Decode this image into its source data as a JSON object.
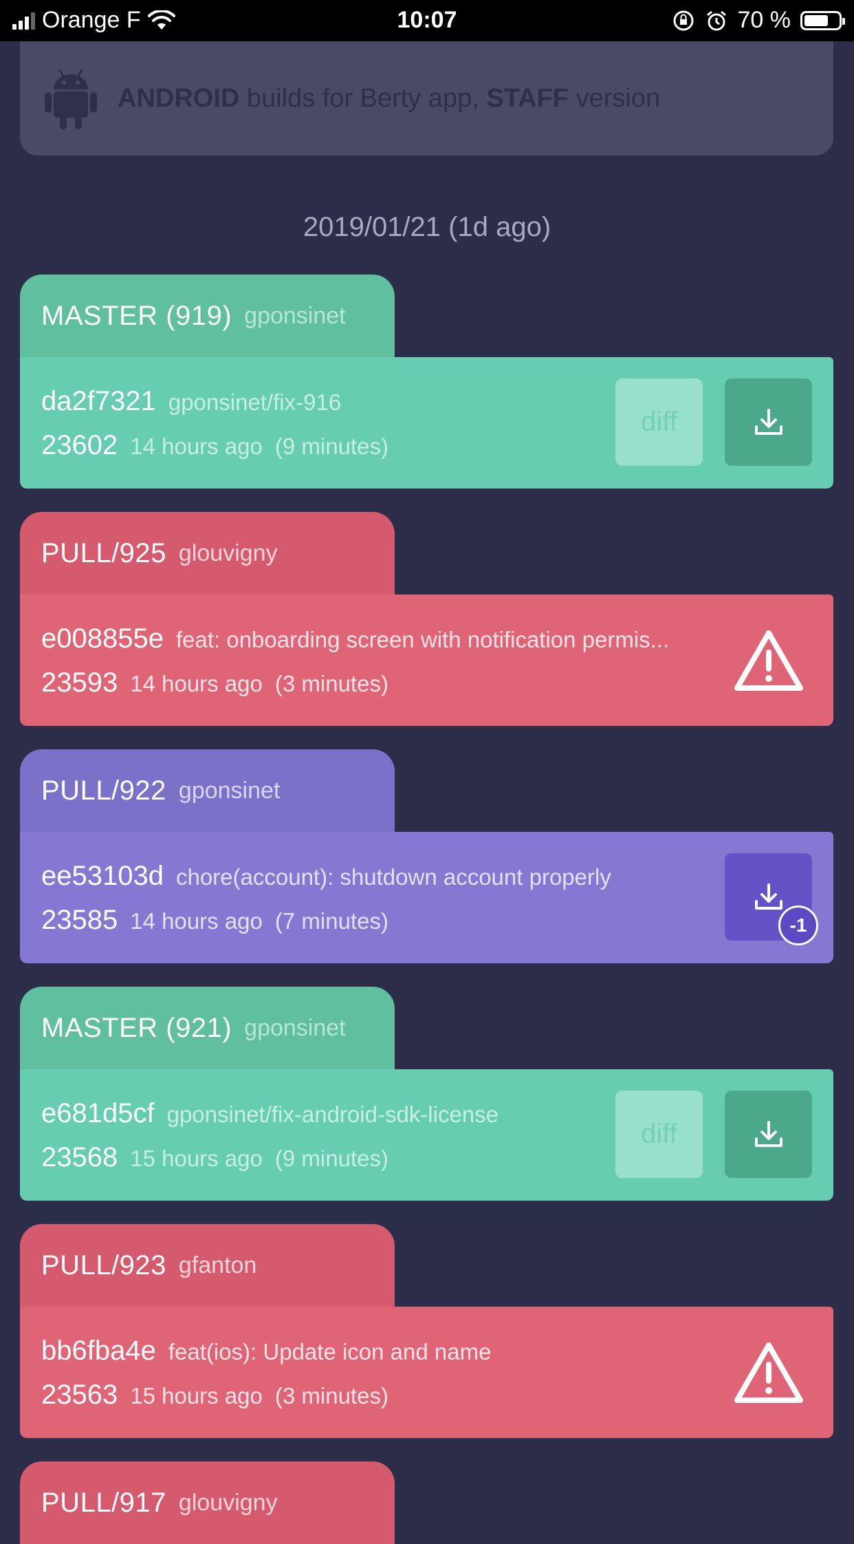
{
  "status_bar": {
    "carrier": "Orange F",
    "time": "10:07",
    "battery": "70 %",
    "battery_level": 0.7
  },
  "banner": {
    "platform": "ANDROID",
    "text_mid": " builds for Berty app, ",
    "variant": "STAFF",
    "text_end": " version"
  },
  "date_header": "2019/01/21 (1d ago)",
  "builds": [
    {
      "kind": "green",
      "branch": "MASTER (919)",
      "author": "gponsinet",
      "hash": "da2f7321",
      "message": "gponsinet/fix-916",
      "number": "23602",
      "ago": "14 hours ago",
      "duration": "(9 minutes)",
      "diff_label": "diff",
      "action": "download"
    },
    {
      "kind": "red",
      "branch": "PULL/925",
      "author": "glouvigny",
      "hash": "e008855e",
      "message": "feat: onboarding screen with notification permis...",
      "number": "23593",
      "ago": "14 hours ago",
      "duration": "(3 minutes)",
      "action": "warning"
    },
    {
      "kind": "purple",
      "branch": "PULL/922",
      "author": "gponsinet",
      "hash": "ee53103d",
      "message": "chore(account): shutdown account properly",
      "number": "23585",
      "ago": "14 hours ago",
      "duration": "(7 minutes)",
      "action": "download",
      "badge": "-1"
    },
    {
      "kind": "green",
      "branch": "MASTER (921)",
      "author": "gponsinet",
      "hash": "e681d5cf",
      "message": "gponsinet/fix-android-sdk-license",
      "number": "23568",
      "ago": "15 hours ago",
      "duration": "(9 minutes)",
      "diff_label": "diff",
      "action": "download"
    },
    {
      "kind": "red",
      "branch": "PULL/923",
      "author": "gfanton",
      "hash": "bb6fba4e",
      "message": "feat(ios): Update icon and name",
      "number": "23563",
      "ago": "15 hours ago",
      "duration": "(3 minutes)",
      "action": "warning"
    },
    {
      "kind": "red",
      "branch": "PULL/917",
      "author": "glouvigny"
    }
  ],
  "icons": {
    "android": "android-icon",
    "download": "download-icon",
    "warning": "warning-icon"
  },
  "colors": {
    "background": "#2c2d48",
    "master_green": "#66cdb0",
    "pull_failed_red": "#df6576",
    "pull_purple": "#8478d2"
  }
}
